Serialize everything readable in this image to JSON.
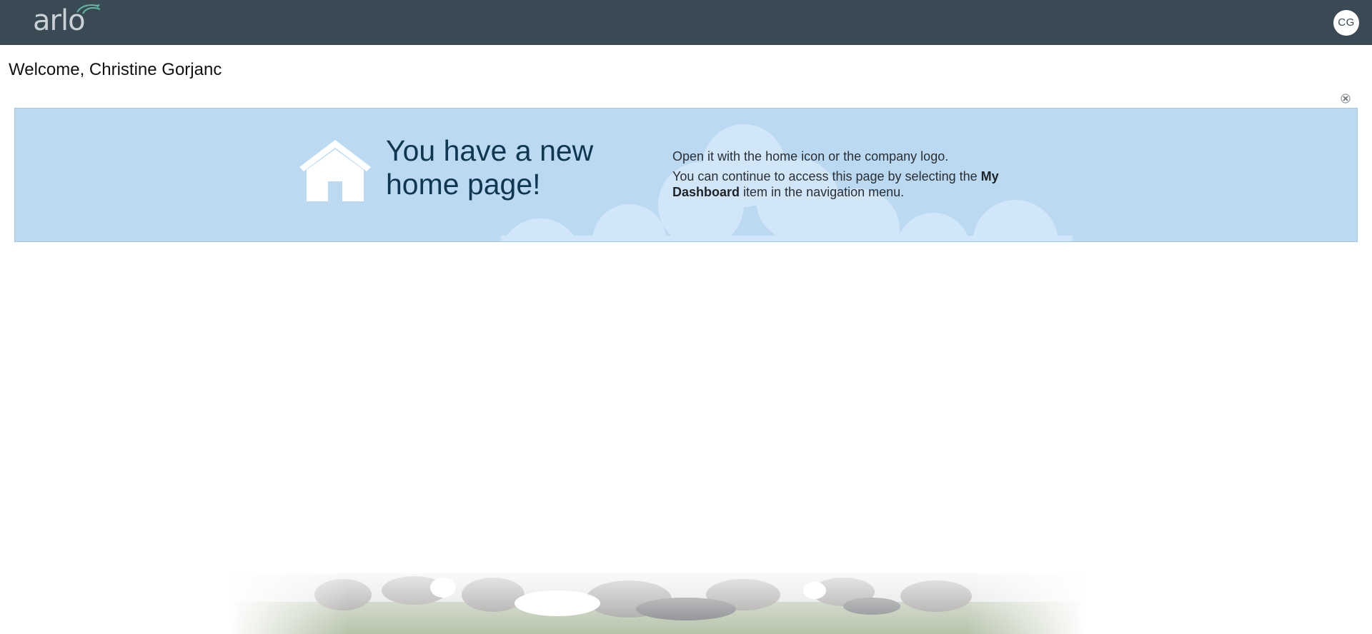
{
  "header": {
    "logo_text": "arlo",
    "user_initials": "CG"
  },
  "welcome": {
    "text": "Welcome, Christine Gorjanc"
  },
  "banner": {
    "headline": "You have a new home page!",
    "info_line1": "Open it with the home icon or the company logo.",
    "info_line2_prefix": "You can continue to access this page by selecting the ",
    "info_line2_bold": "My Dashboard",
    "info_line2_suffix": " item in the navigation menu.",
    "icons": {
      "home": "home-icon",
      "dismiss": "close-icon"
    }
  },
  "colors": {
    "topbar": "#394a54",
    "banner_bg": "#bcd9f2",
    "headline": "#0e3752",
    "logo_accent": "#5fb7a3"
  }
}
